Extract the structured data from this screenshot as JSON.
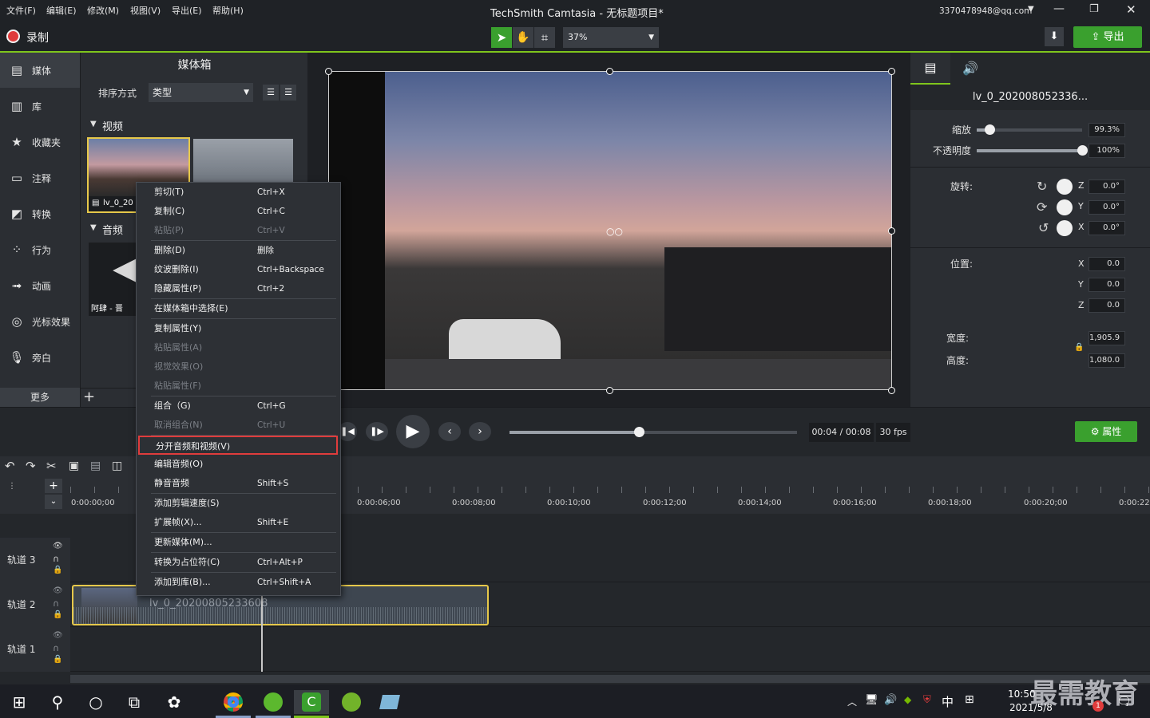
{
  "menu": [
    "文件(F)",
    "编辑(E)",
    "修改(M)",
    "视图(V)",
    "导出(E)",
    "帮助(H)"
  ],
  "window_title": "TechSmith Camtasia - 无标题项目*",
  "account": "3370478948@qq.com",
  "record_label": "录制",
  "zoom": "37%",
  "export_label": "导出",
  "left_tabs": [
    {
      "label": "媒体",
      "icon": "film-icon"
    },
    {
      "label": "库",
      "icon": "library-icon"
    },
    {
      "label": "收藏夹",
      "icon": "star-icon"
    },
    {
      "label": "注释",
      "icon": "annotation-icon"
    },
    {
      "label": "转换",
      "icon": "transition-icon"
    },
    {
      "label": "行为",
      "icon": "behavior-icon"
    },
    {
      "label": "动画",
      "icon": "animation-icon"
    },
    {
      "label": "光标效果",
      "icon": "cursor-icon"
    },
    {
      "label": "旁白",
      "icon": "microphone-icon"
    }
  ],
  "more_label": "更多",
  "mediabin": {
    "title": "媒体箱",
    "sort_label": "排序方式",
    "sort_value": "类型",
    "video_section": "视频",
    "audio_section": "音频",
    "clip1_label": "lv_0_20",
    "audio_label": "阿肆 - 晋"
  },
  "props": {
    "clip_name": "lv_0_202008052336...",
    "scale_label": "缩放",
    "scale_value": "99.3%",
    "scale_level": 0.12,
    "opacity_label": "不透明度",
    "opacity_value": "100%",
    "opacity_level": 1.0,
    "rotate_label": "旋转:",
    "rot_z": "0.0°",
    "rot_y": "0.0°",
    "rot_x": "0.0°",
    "pos_label": "位置:",
    "pos_x": "0.0",
    "pos_y": "0.0",
    "pos_z": "0.0",
    "width_label": "宽度:",
    "width_value": "1,905.9",
    "height_label": "高度:",
    "height_value": "1,080.0",
    "axis_z": "Z",
    "axis_y": "Y",
    "axis_x": "X"
  },
  "playback": {
    "time": "00:04 / 00:08",
    "fps": "30 fps",
    "progress": 0.45,
    "props_button": "属性"
  },
  "timeline": {
    "ticks": [
      "0:00:00;00",
      "0:00:06;00",
      "0:00:08;00",
      "0:00:10;00",
      "0:00:12;00",
      "0:00:14;00",
      "0:00:16;00",
      "0:00:18;00",
      "0:00:20;00",
      "0:00:22"
    ],
    "tracks": [
      "轨道 3",
      "轨道 2",
      "轨道 1"
    ],
    "clip_label": "lv_0_20200805233608"
  },
  "context_menu": [
    {
      "label": "剪切(T)",
      "shortcut": "Ctrl+X",
      "enabled": true
    },
    {
      "label": "复制(C)",
      "shortcut": "Ctrl+C",
      "enabled": true
    },
    {
      "label": "粘贴(P)",
      "shortcut": "Ctrl+V",
      "enabled": false
    },
    {
      "label": "删除(D)",
      "shortcut": "删除",
      "enabled": true
    },
    {
      "label": "纹波删除(I)",
      "shortcut": "Ctrl+Backspace",
      "enabled": true
    },
    {
      "label": "隐藏属性(P)",
      "shortcut": "Ctrl+2",
      "enabled": true
    },
    {
      "label": "在媒体箱中选择(E)",
      "shortcut": "",
      "enabled": true
    },
    {
      "label": "复制属性(Y)",
      "shortcut": "",
      "enabled": true
    },
    {
      "label": "粘贴属性(A)",
      "shortcut": "",
      "enabled": false
    },
    {
      "label": "视觉效果(O)",
      "shortcut": "",
      "enabled": false
    },
    {
      "label": "粘贴属性(F)",
      "shortcut": "",
      "enabled": false
    },
    {
      "label": "组合（G)",
      "shortcut": "Ctrl+G",
      "enabled": true
    },
    {
      "label": "取消组合(N)",
      "shortcut": "Ctrl+U",
      "enabled": false
    },
    {
      "label": "分开音频和视频(V)",
      "shortcut": "",
      "enabled": true,
      "highlight": true
    },
    {
      "label": "编辑音频(O)",
      "shortcut": "",
      "enabled": true
    },
    {
      "label": "静音音频",
      "shortcut": "Shift+S",
      "enabled": true
    },
    {
      "label": "添加剪辑速度(S)",
      "shortcut": "",
      "enabled": true
    },
    {
      "label": "扩展帧(X)...",
      "shortcut": "Shift+E",
      "enabled": true
    },
    {
      "label": "更新媒体(M)...",
      "shortcut": "",
      "enabled": true
    },
    {
      "label": "转换为占位符(C)",
      "shortcut": "Ctrl+Alt+P",
      "enabled": true
    },
    {
      "label": "添加到库(B)...",
      "shortcut": "Ctrl+Shift+A",
      "enabled": true
    }
  ],
  "taskbar": {
    "time": "10:50",
    "date": "2021/5/8",
    "ime": "中",
    "watermark": "最需教育",
    "notification_count": "1"
  },
  "colors": {
    "accent_green": "#3aa02e",
    "highlight_red": "#e03c3c",
    "clip_border": "#e6c84a"
  }
}
